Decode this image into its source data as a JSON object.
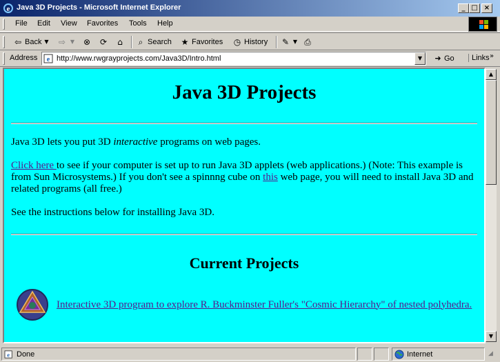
{
  "window": {
    "title": "Java 3D Projects - Microsoft Internet Explorer",
    "controls": {
      "minimize": "_",
      "maximize": "□",
      "close": "×"
    }
  },
  "menu": {
    "items": [
      "File",
      "Edit",
      "View",
      "Favorites",
      "Tools",
      "Help"
    ]
  },
  "toolbar": {
    "back_label": "Back",
    "search_label": "Search",
    "favorites_label": "Favorites",
    "history_label": "History",
    "icons": [
      "back-arrow-icon",
      "forward-arrow-icon",
      "stop-icon",
      "refresh-icon",
      "home-icon",
      "search-icon",
      "favorites-icon",
      "history-icon",
      "edit-icon",
      "print-icon"
    ]
  },
  "address": {
    "label": "Address",
    "url": "http://www.rwgrayprojects.com/Java3D/Intro.html",
    "go_label": "Go",
    "links_label": "Links",
    "links_chevron": "»"
  },
  "page": {
    "title": "Java 3D Projects",
    "intro_before": "Java 3D lets you put 3D ",
    "intro_em": "interactive",
    "intro_after": " programs on web pages.",
    "p2_link": "Click here ",
    "p2_mid": "to see if your computer is set up to run Java 3D applets (web applications.) (Note: This example is from Sun Microsystems.) If you don't see a spinnng cube on ",
    "p2_link2": "this",
    "p2_end": " web page, you will need to install Java 3D and related programs (all free.)",
    "p3": "See the instructions below for installing Java 3D.",
    "section_title": "Current Projects",
    "project_link": "Interactive 3D program to explore R. Buckminster Fuller's \"Cosmic Hierarchy\" of nested polyhedra."
  },
  "status": {
    "text": "Done",
    "zone": "Internet"
  },
  "colors": {
    "page_bg": "#00ffff",
    "link": "#551a8b",
    "title_bar_start": "#0a246a",
    "title_bar_end": "#a6caf0",
    "chrome": "#d4d0c8"
  }
}
